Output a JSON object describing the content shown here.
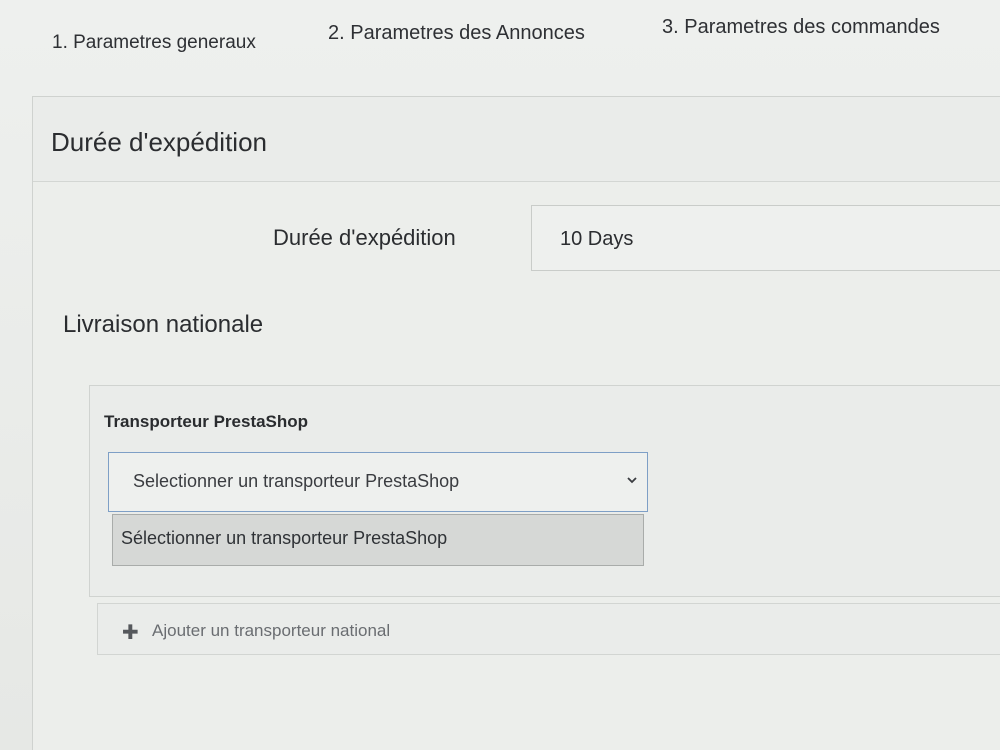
{
  "tabs": [
    {
      "label": "1. Parametres generaux"
    },
    {
      "label": "2. Parametres des Annonces"
    },
    {
      "label": "3. Parametres des commandes"
    }
  ],
  "shipping_duration_panel": {
    "title": "Durée d'expédition",
    "field_label": "Durée d'expédition",
    "field_value": "10 Days"
  },
  "national_delivery": {
    "title": "Livraison nationale",
    "carrier_label": "Transporteur PrestaShop",
    "select_value": "Selectionner un transporteur PrestaShop",
    "dropdown_options": [
      "Sélectionner un transporteur PrestaShop"
    ],
    "add_button_label": "Ajouter un transporteur national"
  },
  "icons": {
    "select_arrow": "chevron-down-icon",
    "add": "plus-icon"
  }
}
